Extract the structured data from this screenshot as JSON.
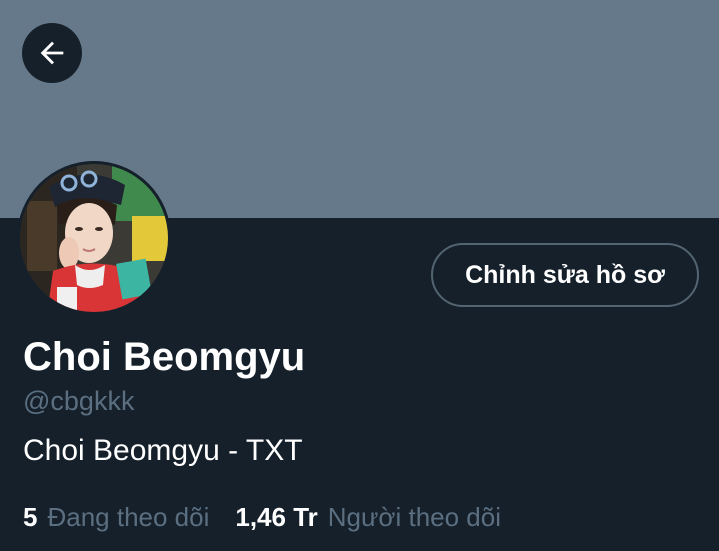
{
  "profile": {
    "display_name": "Choi Beomgyu",
    "handle": "@cbgkkk",
    "bio": "Choi Beomgyu - TXT",
    "edit_button_label": "Chỉnh sửa hồ sơ"
  },
  "stats": {
    "following_count": "5",
    "following_label": "Đang theo dõi",
    "followers_count": "1,46 Tr",
    "followers_label": "Người theo dõi"
  },
  "icons": {
    "back": "arrow-left-icon"
  },
  "colors": {
    "background": "#15202b",
    "banner": "#66798a",
    "secondary_text": "#5b6f80",
    "button_border": "#536471"
  }
}
